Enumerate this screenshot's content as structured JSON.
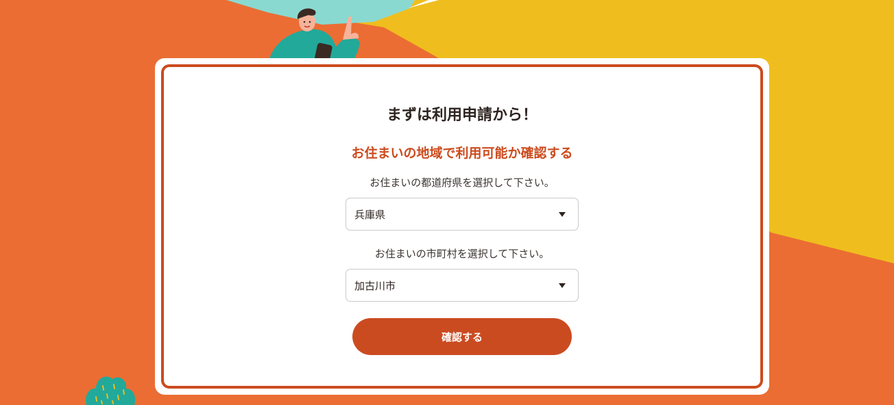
{
  "card": {
    "title": "まずは利用申請から！",
    "subtitle": "お住まいの地域で利用可能か確認する"
  },
  "prefecture": {
    "label": "お住まいの都道府県を選択して下さい。",
    "value": "兵庫県"
  },
  "city": {
    "label": "お住まいの市町村を選択して下さい。",
    "value": "加古川市"
  },
  "confirm_button": {
    "label": "確認する"
  },
  "colors": {
    "background_orange": "#eb6d33",
    "accent_yellow": "#efbe1e",
    "accent_teal": "#8ad9d0",
    "brand_red": "#cc4b1e",
    "card_white": "#ffffff"
  },
  "icons": {
    "person": "person-with-phone-illustration",
    "bush": "bush-illustration",
    "dropdown": "chevron-down-icon"
  }
}
